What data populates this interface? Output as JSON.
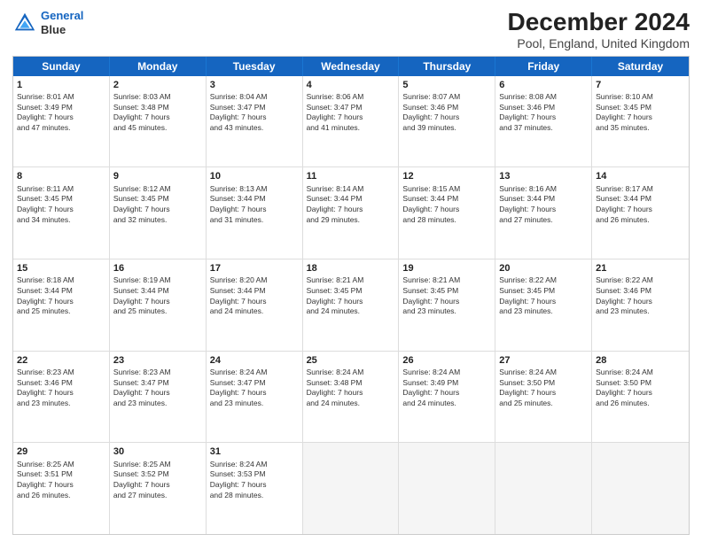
{
  "logo": {
    "line1": "General",
    "line2": "Blue"
  },
  "title": "December 2024",
  "subtitle": "Pool, England, United Kingdom",
  "days": [
    "Sunday",
    "Monday",
    "Tuesday",
    "Wednesday",
    "Thursday",
    "Friday",
    "Saturday"
  ],
  "rows": [
    [
      {
        "num": "1",
        "rise": "Sunrise: 8:01 AM",
        "set": "Sunset: 3:49 PM",
        "day": "Daylight: 7 hours",
        "min": "and 47 minutes."
      },
      {
        "num": "2",
        "rise": "Sunrise: 8:03 AM",
        "set": "Sunset: 3:48 PM",
        "day": "Daylight: 7 hours",
        "min": "and 45 minutes."
      },
      {
        "num": "3",
        "rise": "Sunrise: 8:04 AM",
        "set": "Sunset: 3:47 PM",
        "day": "Daylight: 7 hours",
        "min": "and 43 minutes."
      },
      {
        "num": "4",
        "rise": "Sunrise: 8:06 AM",
        "set": "Sunset: 3:47 PM",
        "day": "Daylight: 7 hours",
        "min": "and 41 minutes."
      },
      {
        "num": "5",
        "rise": "Sunrise: 8:07 AM",
        "set": "Sunset: 3:46 PM",
        "day": "Daylight: 7 hours",
        "min": "and 39 minutes."
      },
      {
        "num": "6",
        "rise": "Sunrise: 8:08 AM",
        "set": "Sunset: 3:46 PM",
        "day": "Daylight: 7 hours",
        "min": "and 37 minutes."
      },
      {
        "num": "7",
        "rise": "Sunrise: 8:10 AM",
        "set": "Sunset: 3:45 PM",
        "day": "Daylight: 7 hours",
        "min": "and 35 minutes."
      }
    ],
    [
      {
        "num": "8",
        "rise": "Sunrise: 8:11 AM",
        "set": "Sunset: 3:45 PM",
        "day": "Daylight: 7 hours",
        "min": "and 34 minutes."
      },
      {
        "num": "9",
        "rise": "Sunrise: 8:12 AM",
        "set": "Sunset: 3:45 PM",
        "day": "Daylight: 7 hours",
        "min": "and 32 minutes."
      },
      {
        "num": "10",
        "rise": "Sunrise: 8:13 AM",
        "set": "Sunset: 3:44 PM",
        "day": "Daylight: 7 hours",
        "min": "and 31 minutes."
      },
      {
        "num": "11",
        "rise": "Sunrise: 8:14 AM",
        "set": "Sunset: 3:44 PM",
        "day": "Daylight: 7 hours",
        "min": "and 29 minutes."
      },
      {
        "num": "12",
        "rise": "Sunrise: 8:15 AM",
        "set": "Sunset: 3:44 PM",
        "day": "Daylight: 7 hours",
        "min": "and 28 minutes."
      },
      {
        "num": "13",
        "rise": "Sunrise: 8:16 AM",
        "set": "Sunset: 3:44 PM",
        "day": "Daylight: 7 hours",
        "min": "and 27 minutes."
      },
      {
        "num": "14",
        "rise": "Sunrise: 8:17 AM",
        "set": "Sunset: 3:44 PM",
        "day": "Daylight: 7 hours",
        "min": "and 26 minutes."
      }
    ],
    [
      {
        "num": "15",
        "rise": "Sunrise: 8:18 AM",
        "set": "Sunset: 3:44 PM",
        "day": "Daylight: 7 hours",
        "min": "and 25 minutes."
      },
      {
        "num": "16",
        "rise": "Sunrise: 8:19 AM",
        "set": "Sunset: 3:44 PM",
        "day": "Daylight: 7 hours",
        "min": "and 25 minutes."
      },
      {
        "num": "17",
        "rise": "Sunrise: 8:20 AM",
        "set": "Sunset: 3:44 PM",
        "day": "Daylight: 7 hours",
        "min": "and 24 minutes."
      },
      {
        "num": "18",
        "rise": "Sunrise: 8:21 AM",
        "set": "Sunset: 3:45 PM",
        "day": "Daylight: 7 hours",
        "min": "and 24 minutes."
      },
      {
        "num": "19",
        "rise": "Sunrise: 8:21 AM",
        "set": "Sunset: 3:45 PM",
        "day": "Daylight: 7 hours",
        "min": "and 23 minutes."
      },
      {
        "num": "20",
        "rise": "Sunrise: 8:22 AM",
        "set": "Sunset: 3:45 PM",
        "day": "Daylight: 7 hours",
        "min": "and 23 minutes."
      },
      {
        "num": "21",
        "rise": "Sunrise: 8:22 AM",
        "set": "Sunset: 3:46 PM",
        "day": "Daylight: 7 hours",
        "min": "and 23 minutes."
      }
    ],
    [
      {
        "num": "22",
        "rise": "Sunrise: 8:23 AM",
        "set": "Sunset: 3:46 PM",
        "day": "Daylight: 7 hours",
        "min": "and 23 minutes."
      },
      {
        "num": "23",
        "rise": "Sunrise: 8:23 AM",
        "set": "Sunset: 3:47 PM",
        "day": "Daylight: 7 hours",
        "min": "and 23 minutes."
      },
      {
        "num": "24",
        "rise": "Sunrise: 8:24 AM",
        "set": "Sunset: 3:47 PM",
        "day": "Daylight: 7 hours",
        "min": "and 23 minutes."
      },
      {
        "num": "25",
        "rise": "Sunrise: 8:24 AM",
        "set": "Sunset: 3:48 PM",
        "day": "Daylight: 7 hours",
        "min": "and 24 minutes."
      },
      {
        "num": "26",
        "rise": "Sunrise: 8:24 AM",
        "set": "Sunset: 3:49 PM",
        "day": "Daylight: 7 hours",
        "min": "and 24 minutes."
      },
      {
        "num": "27",
        "rise": "Sunrise: 8:24 AM",
        "set": "Sunset: 3:50 PM",
        "day": "Daylight: 7 hours",
        "min": "and 25 minutes."
      },
      {
        "num": "28",
        "rise": "Sunrise: 8:24 AM",
        "set": "Sunset: 3:50 PM",
        "day": "Daylight: 7 hours",
        "min": "and 26 minutes."
      }
    ],
    [
      {
        "num": "29",
        "rise": "Sunrise: 8:25 AM",
        "set": "Sunset: 3:51 PM",
        "day": "Daylight: 7 hours",
        "min": "and 26 minutes."
      },
      {
        "num": "30",
        "rise": "Sunrise: 8:25 AM",
        "set": "Sunset: 3:52 PM",
        "day": "Daylight: 7 hours",
        "min": "and 27 minutes."
      },
      {
        "num": "31",
        "rise": "Sunrise: 8:24 AM",
        "set": "Sunset: 3:53 PM",
        "day": "Daylight: 7 hours",
        "min": "and 28 minutes."
      },
      null,
      null,
      null,
      null
    ]
  ]
}
